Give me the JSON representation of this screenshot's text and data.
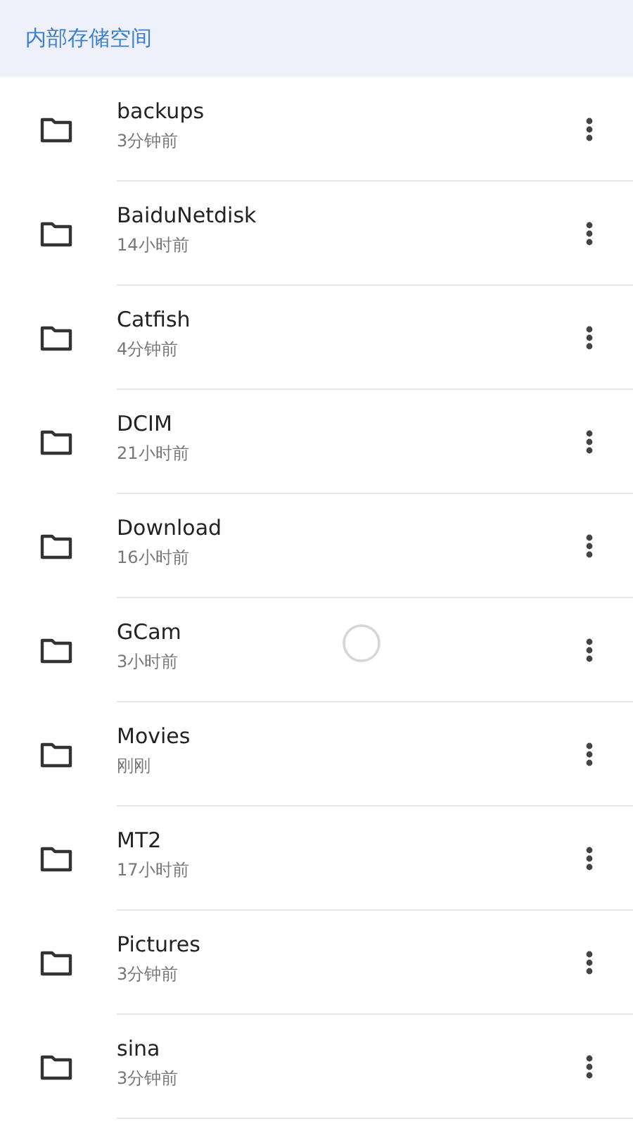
{
  "header": {
    "title": "内部存储空间"
  },
  "folders": [
    {
      "name": "backups",
      "modified": "3分钟前"
    },
    {
      "name": "BaiduNetdisk",
      "modified": "14小时前"
    },
    {
      "name": "Catfish",
      "modified": "4分钟前"
    },
    {
      "name": "DCIM",
      "modified": "21小时前"
    },
    {
      "name": "Download",
      "modified": "16小时前"
    },
    {
      "name": "GCam",
      "modified": "3小时前"
    },
    {
      "name": "Movies",
      "modified": "刚刚"
    },
    {
      "name": "MT2",
      "modified": "17小时前"
    },
    {
      "name": "Pictures",
      "modified": "3分钟前"
    },
    {
      "name": "sina",
      "modified": "3分钟前"
    }
  ],
  "loading": true
}
